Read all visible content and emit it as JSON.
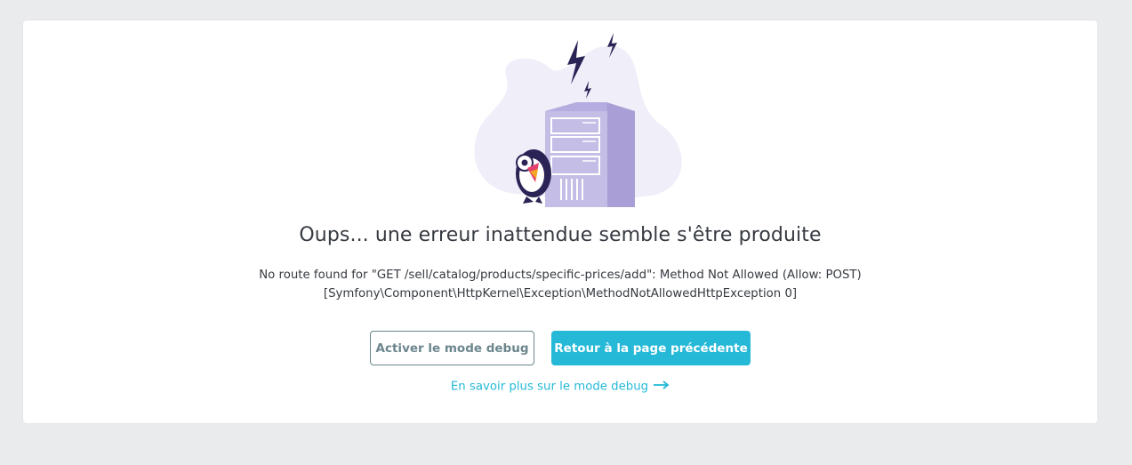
{
  "error": {
    "title": "Oups... une erreur inattendue semble s'être produite",
    "message_line1": "No route found for \"GET /sell/catalog/products/specific-prices/add\": Method Not Allowed (Allow: POST)",
    "message_line2": "[Symfony\\Component\\HttpKernel\\Exception\\MethodNotAllowedHttpException 0]"
  },
  "actions": {
    "debug_button_label": "Activer le mode debug",
    "back_button_label": "Retour à la page précédente",
    "learn_more_link": "En savoir plus sur le mode debug",
    "learn_more_icon": "arrow-right-icon"
  },
  "illustration": {
    "icon": "server-error-illustration",
    "blob_color": "#f0eef9",
    "server_color": "#c4bde6",
    "bolt_color": "#2a2356"
  },
  "colors": {
    "accent": "#25b9d7",
    "outline": "#6c868e",
    "text": "#363a41",
    "background": "#eaebec"
  }
}
